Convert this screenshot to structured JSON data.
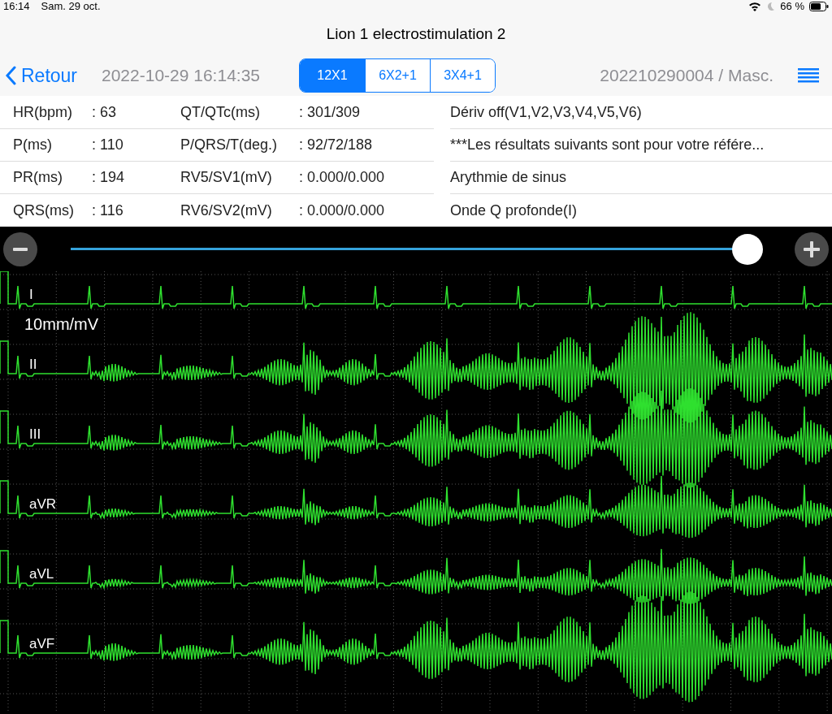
{
  "status_bar": {
    "time": "16:14",
    "date": "Sam. 29 oct.",
    "battery": "66 %"
  },
  "title": "Lion 1 electrostimulation 2",
  "nav": {
    "back": "Retour",
    "datetime": "2022-10-29 16:14:35",
    "record": "202210290004 / Masc."
  },
  "layouts": [
    {
      "label": "12X1",
      "selected": true
    },
    {
      "label": "6X2+1",
      "selected": false
    },
    {
      "label": "3X4+1",
      "selected": false
    }
  ],
  "measurements": [
    {
      "label": "HR(bpm)",
      "value": ": 63",
      "label_2": "QT/QTc(ms)",
      "value_2": ": 301/309",
      "note": "Dériv off(V1,V2,V3,V4,V5,V6)"
    },
    {
      "label": "P(ms)",
      "value": ": 110",
      "label_2": "P/QRS/T(deg.)",
      "value_2": ": 92/72/188",
      "note": "***Les résultats suivants sont pour votre référe..."
    },
    {
      "label": "PR(ms)",
      "value": ": 194",
      "label_2": "RV5/SV1(mV)",
      "value_2": ": 0.000/0.000",
      "note": "Arythmie de sinus"
    },
    {
      "label": "QRS(ms)",
      "value": ": 116",
      "label_2": "RV6/SV2(mV)",
      "value_2": ": 0.000/0.000",
      "note": "Onde Q profonde(I)"
    }
  ],
  "slider": {
    "level": 0.98
  },
  "gain": "10mm/mV",
  "leads": [
    "I",
    "II",
    "III",
    "aVR",
    "aVL",
    "aVF"
  ]
}
